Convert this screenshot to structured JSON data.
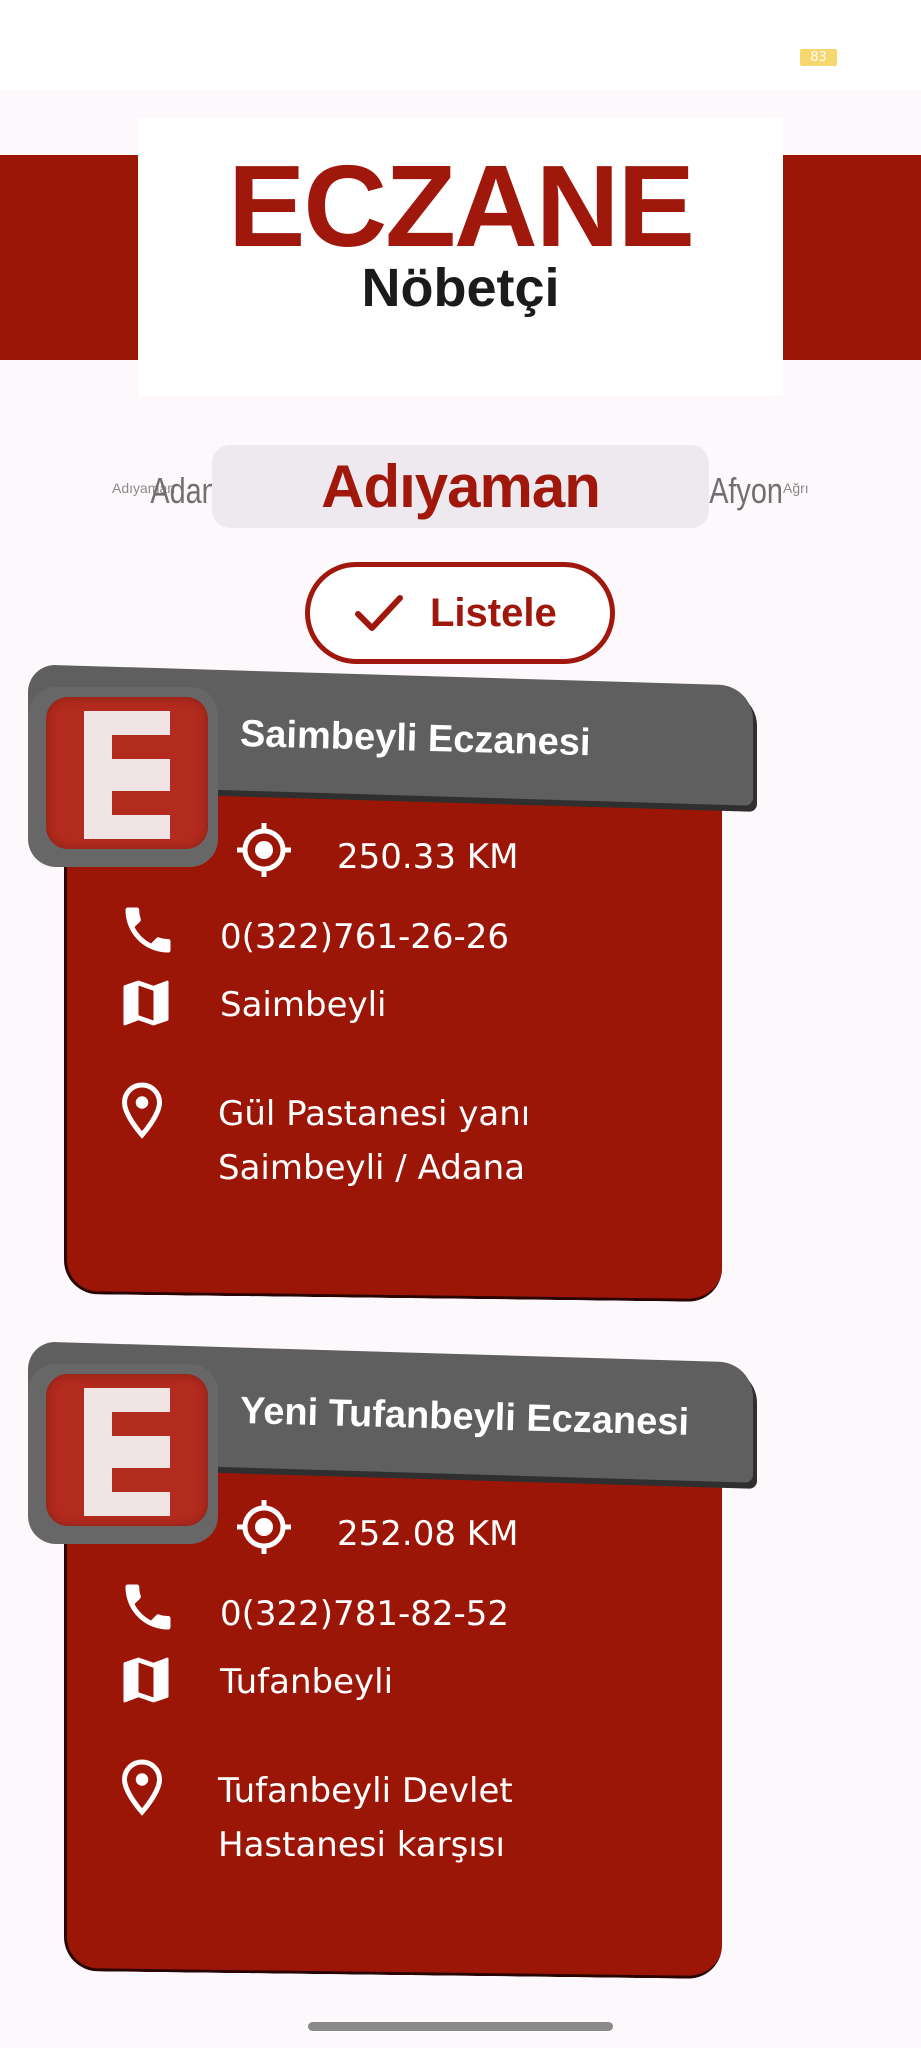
{
  "status_bar": {
    "battery": "83"
  },
  "header": {
    "title": "ECZANE",
    "subtitle": "Nöbetçi"
  },
  "city_picker": {
    "prev_far": "Adıyaman",
    "prev": "Adana",
    "selected": "Adıyaman",
    "next": "Afyon",
    "next_far": "Ağrı"
  },
  "list_button": {
    "label": "Listele",
    "icon": "check-icon"
  },
  "pharmacies": [
    {
      "name": "Saimbeyli Eczanesi",
      "distance": "250.33 KM",
      "phone": "0(322)761-26-26",
      "district": "Saimbeyli",
      "address": "Gül Pastanesi yanı Saimbeyli / Adana"
    },
    {
      "name": "Yeni Tufanbeyli Eczanesi",
      "distance": "252.08 KM",
      "phone": "0(322)781-82-52",
      "district": "Tufanbeyli",
      "address": "Tufanbeyli Devlet Hastanesi karşısı"
    }
  ],
  "colors": {
    "brand_red": "#9c1608",
    "header_gray": "#5f5f5f",
    "background": "#fdf8fc"
  }
}
